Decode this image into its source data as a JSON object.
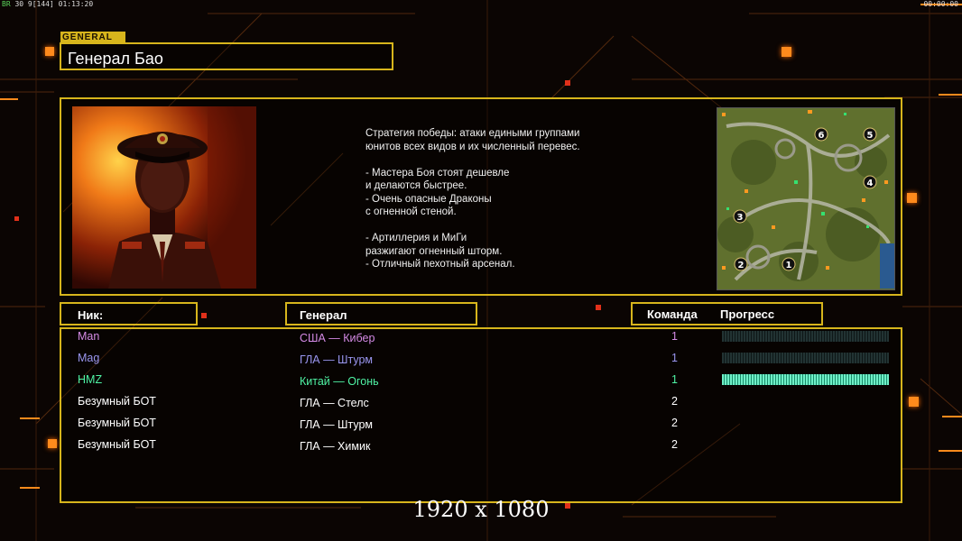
{
  "hud": {
    "top_left_prefix": "BR",
    "top_left_stats": "30 9[144] 01:13:20",
    "top_right_time": "00:00:00"
  },
  "header": {
    "tag": "GENERAL",
    "title": "Генерал Бао"
  },
  "description": {
    "lines": [
      "Стратегия победы: атаки едиными группами",
      "юнитов всех видов и их численный перевес.",
      "",
      "- Мастера Боя стоят дешевле",
      "и делаются быстрее.",
      "- Очень опасные Драконы",
      "с огненной стеной.",
      "",
      "- Артиллерия и МиГи",
      "разжигают огненный шторм.",
      "- Отличный пехотный арсенал."
    ]
  },
  "minimap": {
    "start_positions": [
      "1",
      "2",
      "3",
      "4",
      "5",
      "6"
    ]
  },
  "table": {
    "headers": {
      "nick": "Ник:",
      "general": "Генерал",
      "team": "Команда",
      "progress": "Прогресс"
    },
    "rows": [
      {
        "nick": "Man",
        "general": "США — Кибер",
        "team": "1",
        "color": "#d58be6",
        "progress": 0
      },
      {
        "nick": "Mag",
        "general": "ГЛА — Штурм",
        "team": "1",
        "color": "#9a96f0",
        "progress": 0
      },
      {
        "nick": "HMZ",
        "general": "Китай — Огонь",
        "team": "1",
        "color": "#4ff3a4",
        "progress": 1.0
      },
      {
        "nick": "Безумный БОТ",
        "general": "ГЛА — Стелс",
        "team": "2",
        "color": "#ffffff",
        "progress": null
      },
      {
        "nick": "Безумный БОТ",
        "general": "ГЛА — Штурм",
        "team": "2",
        "color": "#ffffff",
        "progress": null
      },
      {
        "nick": "Безумный БОТ",
        "general": "ГЛА — Химик",
        "team": "2",
        "color": "#ffffff",
        "progress": null
      }
    ]
  },
  "footer": {
    "resolution": "1920 x 1080"
  },
  "colors": {
    "frame": "#d7b51c",
    "accent": "#ff8a1c",
    "background": "#0b0503"
  }
}
